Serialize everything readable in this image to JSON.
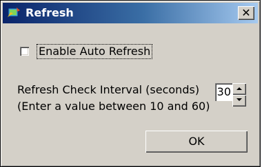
{
  "window": {
    "title": "Refresh",
    "title_icon": "refresh-app-icon",
    "close_glyph": "✕"
  },
  "auto_refresh": {
    "label": "Enable Auto Refresh",
    "checked": false
  },
  "interval": {
    "label_line1": "Refresh Check Interval (seconds)",
    "label_line2": "(Enter a value between 10 and 60)",
    "value": "30"
  },
  "buttons": {
    "ok_label": "OK"
  },
  "colors": {
    "face": "#d4d0c8",
    "title_start": "#0a246a",
    "title_end": "#a6caf0"
  }
}
